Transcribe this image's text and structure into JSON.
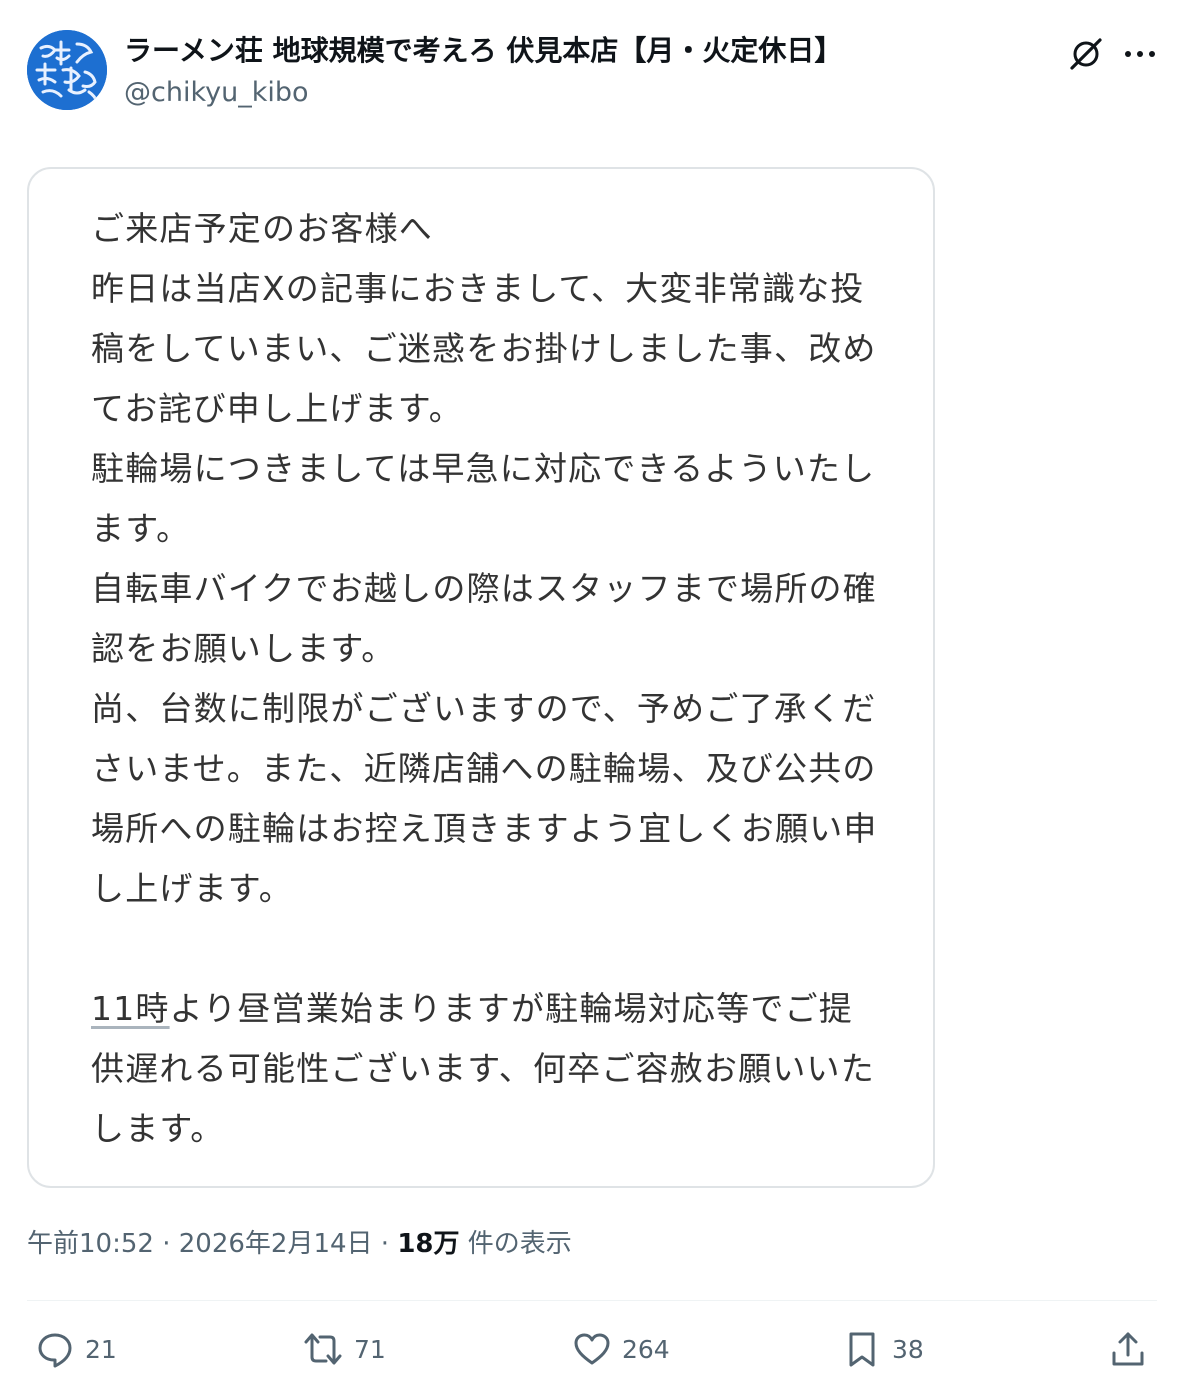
{
  "post": {
    "author": {
      "display_name": "ラーメン荘 地球規模で考えろ 伏見本店【月・火定休日】",
      "handle": "@chikyu_kibo"
    },
    "card": {
      "paragraphs": [
        "ご来店予定のお客様へ",
        "昨日は当店Xの記事におきまして、大変非常識な投稿をしていまい、ご迷惑をお掛けしました事、改めてお詫び申し上げます。",
        "駐輪場につきましては早急に対応できるよういたします。",
        "自転車バイクでお越しの際はスタッフまで場所の確認をお願いします。",
        "尚、台数に制限がございますので、予めご了承くださいませ。また、近隣店舗への駐輪場、及び公共の場所への駐輪はお控え頂きますよう宜しくお願い申し上げます。"
      ],
      "last_time": "11時",
      "last_rest": "より昼営業始まりますが駐輪場対応等でご提供遅れる可能性ございます、何卒ご容赦お願いいたします。"
    },
    "meta": {
      "time": "午前10:52",
      "separator": " · ",
      "date": "2026年2月14日",
      "views": "18万",
      "views_label": " 件の表示"
    },
    "actions": {
      "replies": "21",
      "reposts": "71",
      "likes": "264",
      "bookmarks": "38"
    },
    "colors": {
      "avatar": "#1d6fd1",
      "secondary_text": "#536471",
      "border": "#dfe3e6"
    }
  }
}
